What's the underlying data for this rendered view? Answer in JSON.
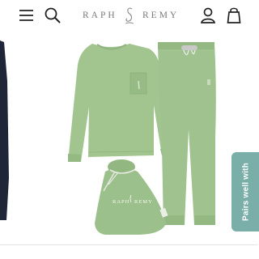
{
  "header": {
    "brand_left": "RAPH",
    "brand_right": "REMY",
    "icons": [
      "menu-icon",
      "search-icon",
      "swan-logo-icon",
      "account-icon",
      "bag-icon"
    ]
  },
  "colors": {
    "garment_green": "#9fc28e",
    "pairs_tab": "#7aafa9",
    "brand_gray": "#7a7a7a"
  },
  "product_image": {
    "bag_text_left": "RAPH",
    "bag_text_right": "REMY"
  },
  "pairs_tab": {
    "label": "Pairs well with"
  }
}
